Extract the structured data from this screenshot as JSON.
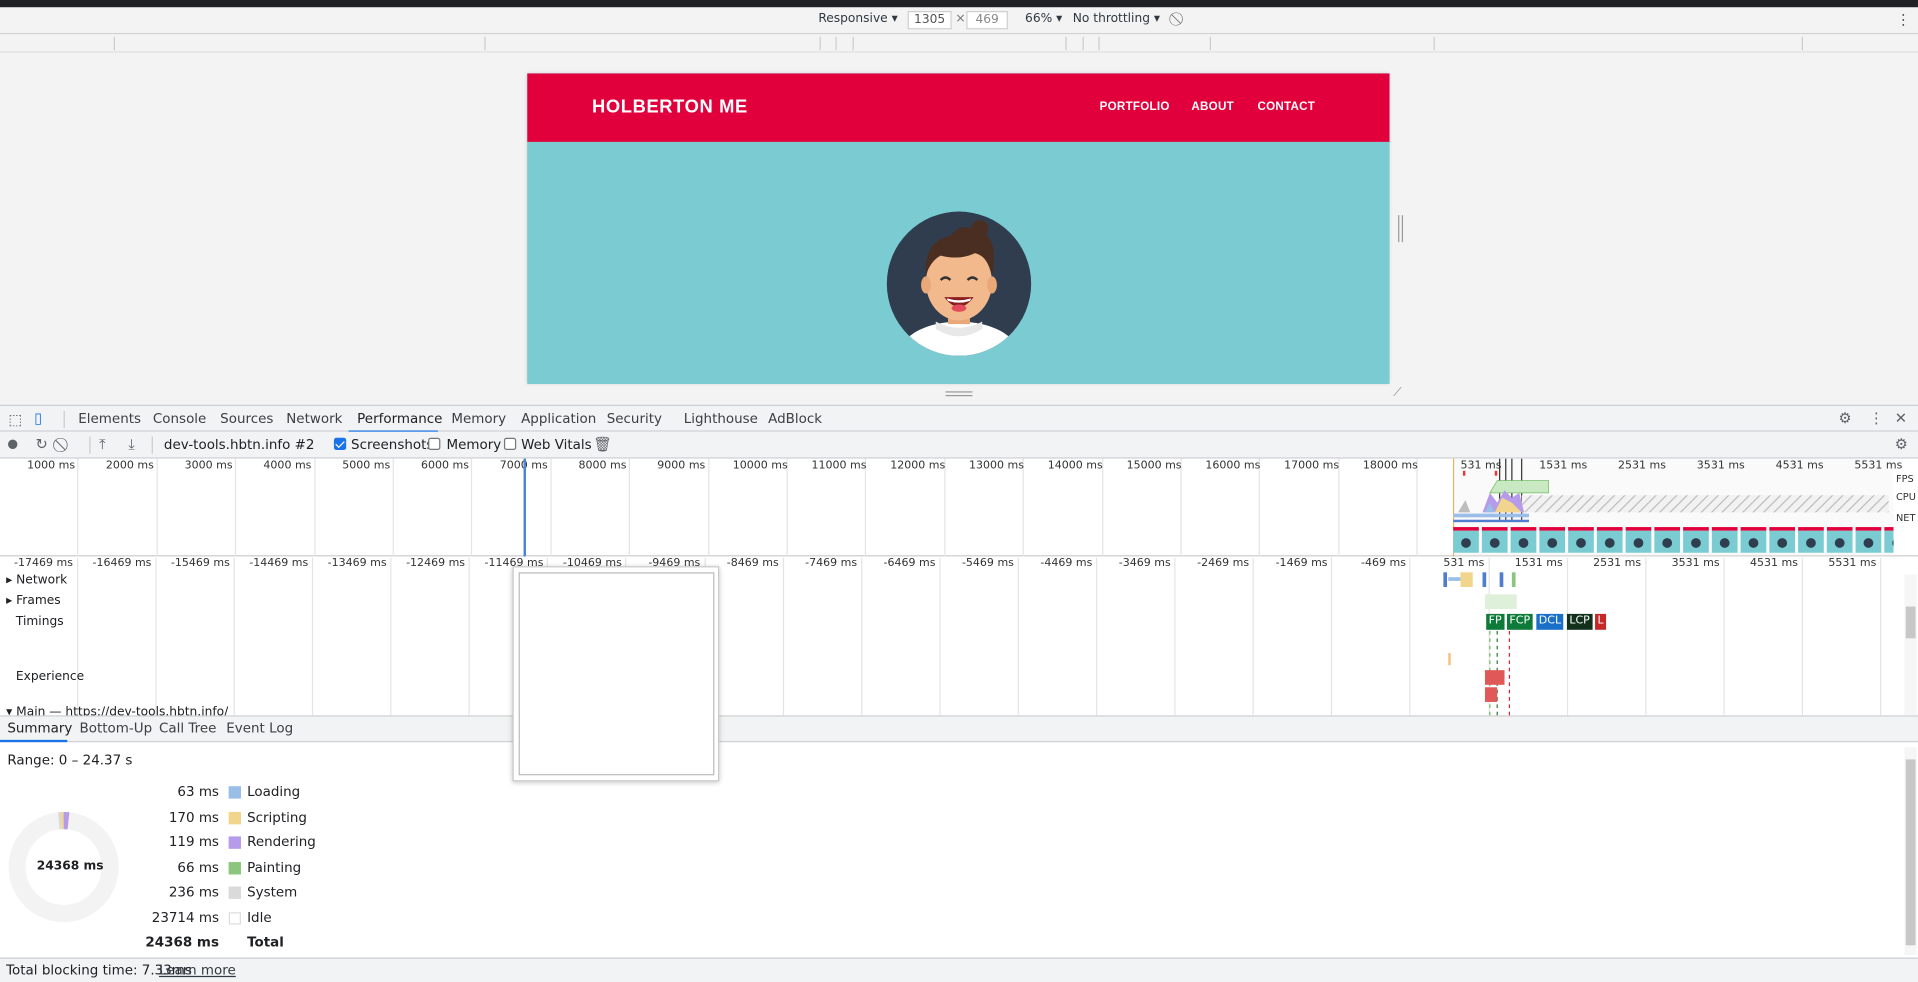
{
  "device_toolbar": {
    "mode": "Responsive",
    "width": "1305",
    "times": "×",
    "height": "469",
    "zoom": "66%",
    "throttling": "No throttling"
  },
  "site": {
    "brand": "HOLBERTON ME",
    "nav": [
      "PORTFOLIO",
      "ABOUT",
      "CONTACT"
    ],
    "colors": {
      "header": "#e1003c",
      "hero": "#7accd2"
    }
  },
  "devtools_tabs": [
    "Elements",
    "Console",
    "Sources",
    "Network",
    "Performance",
    "Memory",
    "Application",
    "Security",
    "Lighthouse",
    "AdBlock"
  ],
  "active_tab": "Performance",
  "perf_toolbar": {
    "recording_select": "dev-tools.hbtn.info #2",
    "screenshots_label": "Screenshots",
    "screenshots_checked": true,
    "memory_label": "Memory",
    "memory_checked": false,
    "webvitals_label": "Web Vitals",
    "webvitals_checked": false
  },
  "overview": {
    "ticks_left": [
      "1000 ms",
      "2000 ms",
      "3000 ms",
      "4000 ms",
      "5000 ms",
      "6000 ms",
      "7000 ms",
      "8000 ms",
      "9000 ms",
      "10000 ms",
      "11000 ms",
      "12000 ms",
      "13000 ms",
      "14000 ms",
      "15000 ms",
      "16000 ms",
      "17000 ms",
      "18000 ms"
    ],
    "ticks_right": [
      "531 ms",
      "1531 ms",
      "2531 ms",
      "3531 ms",
      "4531 ms",
      "5531 ms"
    ],
    "side_labels": [
      "FPS",
      "CPU",
      "NET"
    ]
  },
  "flame": {
    "ticks": [
      "-17469 ms",
      "-16469 ms",
      "-15469 ms",
      "-14469 ms",
      "-13469 ms",
      "-12469 ms",
      "-11469 ms",
      "-10469 ms",
      "-9469 ms",
      "-8469 ms",
      "-7469 ms",
      "-6469 ms",
      "-5469 ms",
      "-4469 ms",
      "-3469 ms",
      "-2469 ms",
      "-1469 ms",
      "-469 ms",
      "531 ms",
      "1531 ms",
      "2531 ms",
      "3531 ms",
      "4531 ms",
      "5531 ms"
    ],
    "tracks": [
      "Network",
      "Frames",
      "Timings",
      "Experience",
      "Main — https://dev-tools.hbtn.info/"
    ],
    "timing_marks": [
      "FP",
      "FCP",
      "DCL",
      "LCP",
      "L"
    ]
  },
  "bottom_tabs": [
    "Summary",
    "Bottom-Up",
    "Call Tree",
    "Event Log"
  ],
  "summary": {
    "range": "Range: 0 – 24.37 s",
    "donut_total": "24368 ms",
    "rows": [
      {
        "value": "63 ms",
        "label": "Loading",
        "color": "#9bbee9"
      },
      {
        "value": "170 ms",
        "label": "Scripting",
        "color": "#f2d58c"
      },
      {
        "value": "119 ms",
        "label": "Rendering",
        "color": "#b59bea"
      },
      {
        "value": "66 ms",
        "label": "Painting",
        "color": "#8cc67e"
      },
      {
        "value": "236 ms",
        "label": "System",
        "color": "#dadada"
      },
      {
        "value": "23714 ms",
        "label": "Idle",
        "color": "#ffffff"
      },
      {
        "value": "24368 ms",
        "label": "Total",
        "color": ""
      }
    ]
  },
  "footer": {
    "blocking": "Total blocking time: 7.33ms",
    "learn_more": "Learn more"
  }
}
